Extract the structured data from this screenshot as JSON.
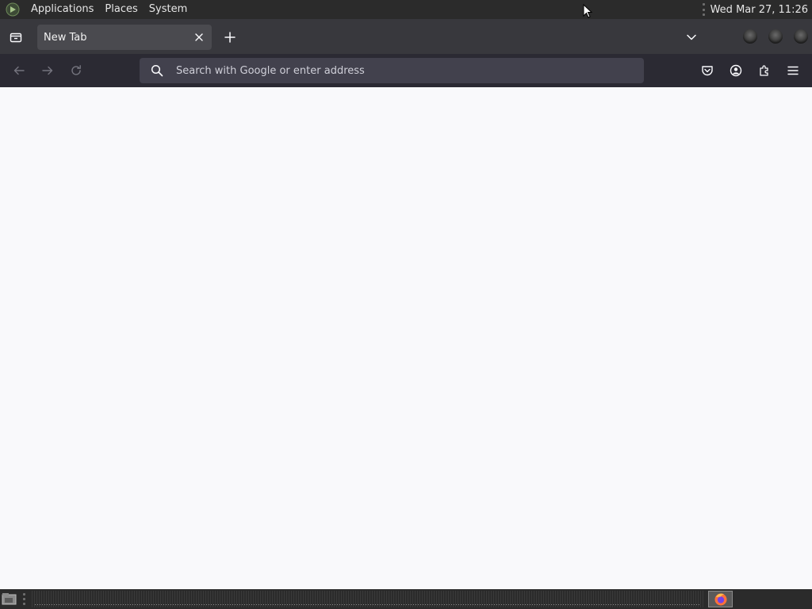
{
  "top_panel": {
    "menus": [
      "Applications",
      "Places",
      "System"
    ],
    "clock": "Wed Mar 27, 11:26"
  },
  "browser": {
    "tab": {
      "title": "New Tab"
    },
    "urlbar": {
      "placeholder": "Search with Google or enter address",
      "value": ""
    }
  },
  "icons": {
    "panel_logo": "mint-menu-icon",
    "tab_overview": "firefox-view-icon",
    "tab_close": "close-icon",
    "new_tab": "plus-icon",
    "list_tabs": "chevron-down-icon",
    "back": "back-arrow-icon",
    "forward": "forward-arrow-icon",
    "reload": "reload-icon",
    "search": "search-icon",
    "pocket": "pocket-icon",
    "account": "account-icon",
    "extensions": "extensions-icon",
    "menu": "hamburger-menu-icon",
    "show_desktop": "show-desktop-icon",
    "firefox_task": "firefox-icon"
  },
  "colors": {
    "panel_bg": "#2b2b2b",
    "tabstrip_bg": "#38383d",
    "navbar_bg": "#2b2a33",
    "urlbar_bg": "#42414d",
    "content_bg": "#f9f9fb"
  }
}
